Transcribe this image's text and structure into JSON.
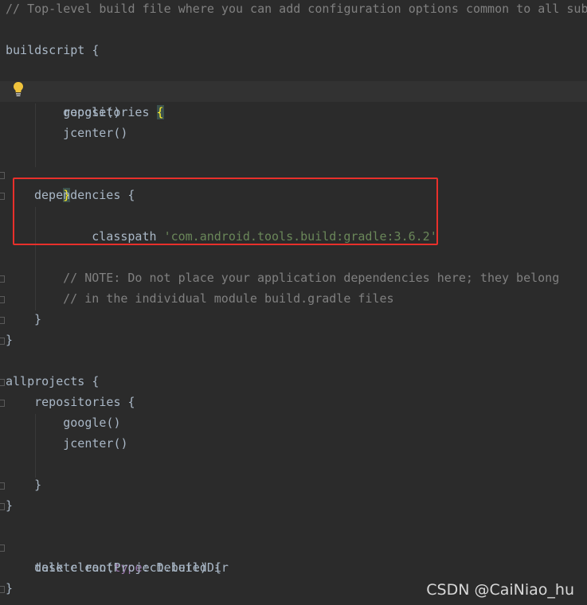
{
  "code_lines": {
    "l1": "// Top-level build file where you can add configuration options common to all sub",
    "l2": "buildscript {",
    "l3_kw": "repositories ",
    "l3_brace": "{",
    "l4": "    google()",
    "l5": "    jcenter()",
    "l6_brace": "}",
    "l7": "dependencies {",
    "l8_kw": "    classpath ",
    "l8_str": "'com.android.tools.build:gradle:3.6.2'",
    "l9": "    // NOTE: Do not place your application dependencies here; they belong",
    "l10": "    // in the individual module build.gradle files",
    "l11": "}",
    "l12": "}",
    "l13": "allprojects {",
    "l14": "    repositories {",
    "l15": "        google()",
    "l16": "        jcenter()",
    "l17": "    }",
    "l18": "}",
    "l19_a": "task clean(",
    "l19_param": "type",
    "l19_b": ": Delete) {",
    "l20": "    delete rootProject.buildDir",
    "l21": "}"
  },
  "watermark": "CSDN @CaiNiao_hu",
  "colors": {
    "background": "#2b2b2b",
    "text": "#a9b7c6",
    "comment": "#808080",
    "string": "#6a8759",
    "param": "#9876aa",
    "highlight_box": "#e8302b",
    "bulb": "#f0c33c"
  },
  "icons": {
    "bulb": "lightbulb-icon",
    "fold": "fold-marker-icon"
  }
}
